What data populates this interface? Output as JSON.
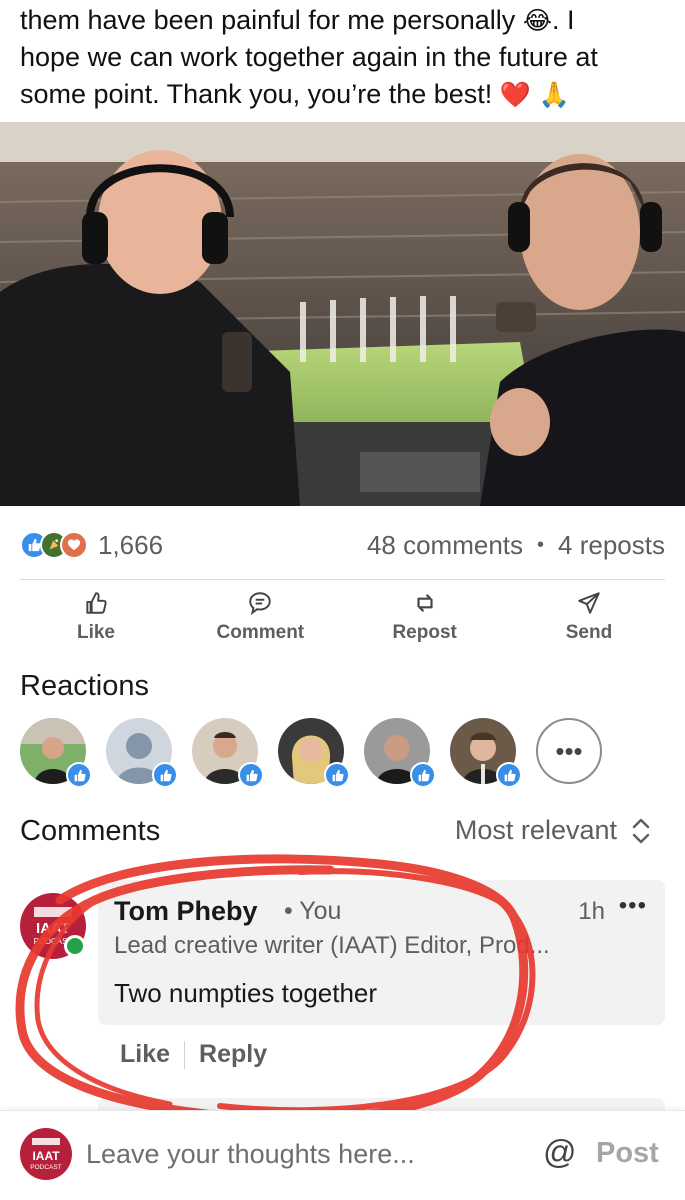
{
  "post": {
    "text_line1": "them have been painful for me personally",
    "emoji_laugh": "😂",
    "text_line1_end": ". I",
    "text_line2": "hope we can work together again in the future at",
    "text_line3": "some point. Thank you, you’re the best!",
    "emoji_heart": "❤️",
    "emoji_pray": "🙏"
  },
  "social": {
    "reaction_count": "1,666",
    "comments": "48 comments",
    "separator": "•",
    "reposts": "4 reposts",
    "reaction_icons": [
      "like-icon",
      "celebrate-icon",
      "love-icon"
    ]
  },
  "actions": {
    "like": "Like",
    "comment": "Comment",
    "repost": "Repost",
    "send": "Send"
  },
  "reactions_section": {
    "title": "Reactions",
    "more": "•••"
  },
  "comments_section": {
    "title": "Comments",
    "sort_label": "Most relevant"
  },
  "comment": {
    "author": "Tom Pheby",
    "relation": "• You",
    "time": "1h",
    "more": "•••",
    "headline": "Lead creative writer (IAAT) Editor, Prod...",
    "text": "Two numpties together",
    "like": "Like",
    "reply": "Reply",
    "avatar_text": "IAAT",
    "avatar_sub": "PODCAST"
  },
  "composer": {
    "placeholder": "Leave your thoughts here...",
    "at": "@",
    "post": "Post",
    "avatar_text": "IAAT",
    "avatar_sub": "PODCAST"
  },
  "colors": {
    "like_blue": "#378fe9",
    "brand_red": "#b7203b",
    "scribble_red": "#e8392e",
    "online_green": "#25a14a"
  }
}
